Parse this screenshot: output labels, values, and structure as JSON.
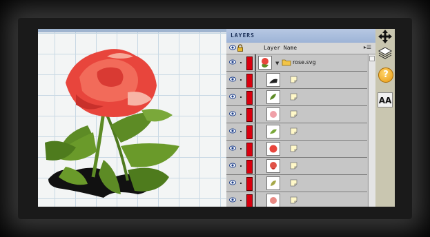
{
  "layers_panel": {
    "title": "LAYERS",
    "header_name": "Layer Name",
    "group": {
      "name": "rose.svg"
    },
    "layers": [
      {
        "thumb": "white-curve"
      },
      {
        "thumb": "green-leaf"
      },
      {
        "thumb": "pink-flower"
      },
      {
        "thumb": "green-leaf"
      },
      {
        "thumb": "red-flower"
      },
      {
        "thumb": "red-flower"
      },
      {
        "thumb": "olive-leaf"
      },
      {
        "thumb": "pink-flower"
      }
    ]
  },
  "toolbar": {
    "aa_label": "AA",
    "help_label": "?"
  },
  "colors": {
    "layer_color": "#d8000f",
    "panel_title_bg": "#9db3d6",
    "rose_red": "#e8453c",
    "leaf_green": "#5d8b25"
  },
  "icons": [
    "eye-icon",
    "lock-icon",
    "folder-icon",
    "note-icon",
    "move-icon",
    "layers-icon",
    "help-icon"
  ]
}
